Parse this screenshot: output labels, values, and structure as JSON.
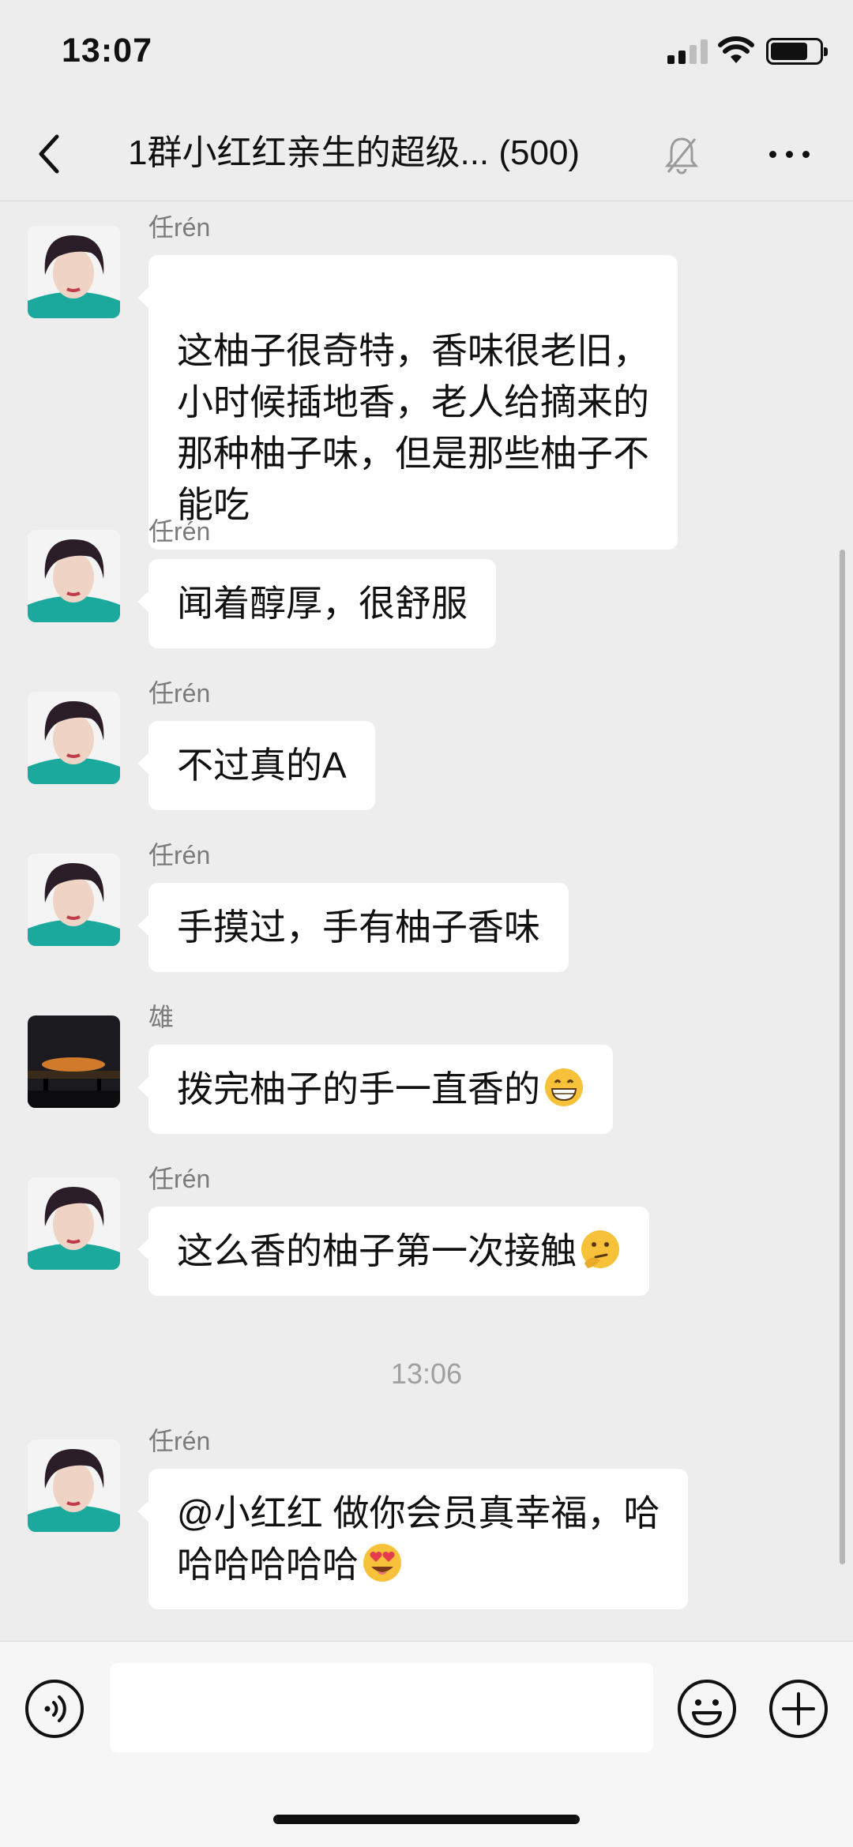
{
  "status_bar": {
    "time": "13:07"
  },
  "header": {
    "title": "1群小红红亲生的超级... (500)"
  },
  "messages": [
    {
      "sender": "任rén",
      "text": "这柚子很奇特，香味很老旧，\n小时候插地香，老人给摘来的\n那种柚子味，但是那些柚子不\n能吃",
      "avatar": "woman-avatar"
    },
    {
      "sender": "任rén",
      "text": "闻着醇厚，很舒服",
      "avatar": "woman-avatar"
    },
    {
      "sender": "任rén",
      "text": "不过真的A",
      "avatar": "woman-avatar"
    },
    {
      "sender": "任rén",
      "text": "手摸过，手有柚子香味",
      "avatar": "woman-avatar"
    },
    {
      "sender": "雄",
      "text": "拨完柚子的手一直香的",
      "emoji": "grinning-face-emoji",
      "avatar": "sunset-avatar"
    },
    {
      "sender": "任rén",
      "text": "这么香的柚子第一次接触",
      "emoji": "thinking-face-emoji",
      "avatar": "woman-avatar"
    },
    {
      "sender": "任rén",
      "text": "@小红红 做你会员真幸福，哈\n哈哈哈哈哈",
      "emoji": "heart-eyes-emoji",
      "avatar": "woman-avatar"
    }
  ],
  "timestamp": "13:06",
  "input": {
    "value": ""
  },
  "colors": {
    "background": "#ededed",
    "bubble": "#ffffff",
    "sender": "#7a7a7a",
    "timestamp": "#a0a0a0"
  },
  "icons": [
    "back-chevron-icon",
    "mute-bell-icon",
    "more-dots-icon",
    "voice-icon",
    "emoji-icon",
    "plus-icon"
  ]
}
